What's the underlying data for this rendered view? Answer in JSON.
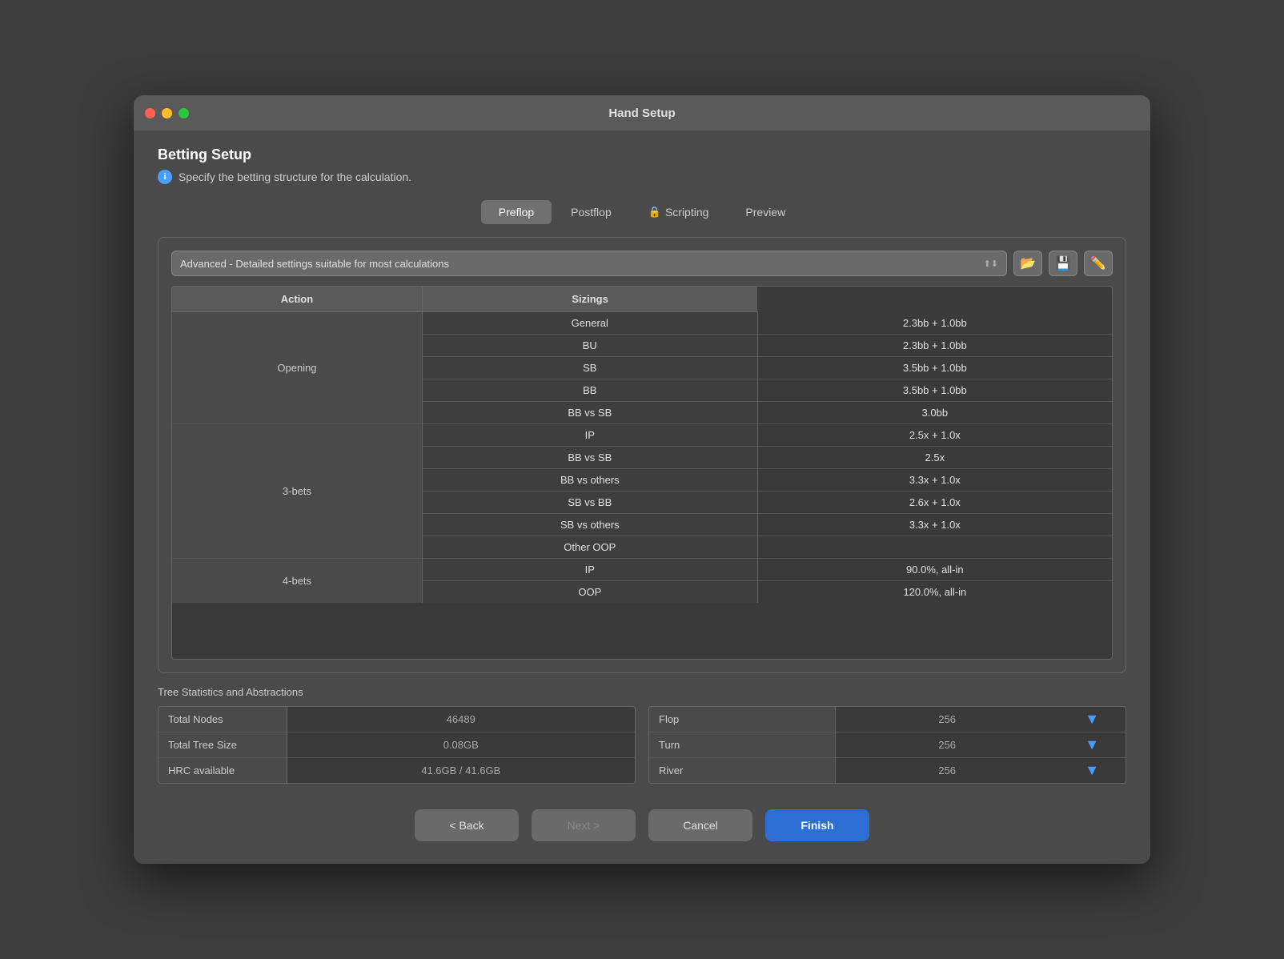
{
  "window": {
    "title": "Hand Setup"
  },
  "header": {
    "title": "Betting Setup",
    "description": "Specify the betting structure for the calculation."
  },
  "tabs": [
    {
      "id": "preflop",
      "label": "Preflop",
      "active": true,
      "icon": ""
    },
    {
      "id": "postflop",
      "label": "Postflop",
      "active": false,
      "icon": ""
    },
    {
      "id": "scripting",
      "label": "Scripting",
      "active": false,
      "icon": "🔒"
    },
    {
      "id": "preview",
      "label": "Preview",
      "active": false,
      "icon": ""
    }
  ],
  "preset": {
    "label": "Advanced - Detailed settings suitable for most calculations"
  },
  "toolbar": {
    "open_icon": "📂",
    "save_icon": "💾",
    "edit_icon": "✏️"
  },
  "table": {
    "headers": [
      "Action",
      "Sizings"
    ],
    "rows": [
      {
        "category": "Opening",
        "action": "General",
        "sizing": "2.3bb + 1.0bb"
      },
      {
        "category": "",
        "action": "BU",
        "sizing": "2.3bb + 1.0bb"
      },
      {
        "category": "",
        "action": "SB",
        "sizing": "3.5bb + 1.0bb"
      },
      {
        "category": "",
        "action": "BB",
        "sizing": "3.5bb + 1.0bb"
      },
      {
        "category": "",
        "action": "BB vs SB",
        "sizing": "3.0bb"
      },
      {
        "category": "3-bets",
        "action": "IP",
        "sizing": "2.5x + 1.0x"
      },
      {
        "category": "",
        "action": "BB vs SB",
        "sizing": "2.5x"
      },
      {
        "category": "",
        "action": "BB vs others",
        "sizing": "3.3x + 1.0x"
      },
      {
        "category": "",
        "action": "SB vs BB",
        "sizing": "2.6x + 1.0x"
      },
      {
        "category": "",
        "action": "SB vs others",
        "sizing": "3.3x + 1.0x"
      },
      {
        "category": "",
        "action": "Other OOP",
        "sizing": ""
      },
      {
        "category": "4-bets",
        "action": "IP",
        "sizing": "90.0%, all-in"
      },
      {
        "category": "",
        "action": "OOP",
        "sizing": "120.0%, all-in"
      }
    ]
  },
  "statistics": {
    "section_label": "Tree Statistics and Abstractions",
    "left_rows": [
      {
        "label": "Total Nodes",
        "value": "46489"
      },
      {
        "label": "Total Tree Size",
        "value": "0.08GB"
      },
      {
        "label": "HRC available",
        "value": "41.6GB / 41.6GB"
      }
    ],
    "right_rows": [
      {
        "label": "Flop",
        "value": "256"
      },
      {
        "label": "Turn",
        "value": "256"
      },
      {
        "label": "River",
        "value": "256"
      }
    ]
  },
  "footer": {
    "back_label": "< Back",
    "next_label": "Next >",
    "cancel_label": "Cancel",
    "finish_label": "Finish"
  }
}
